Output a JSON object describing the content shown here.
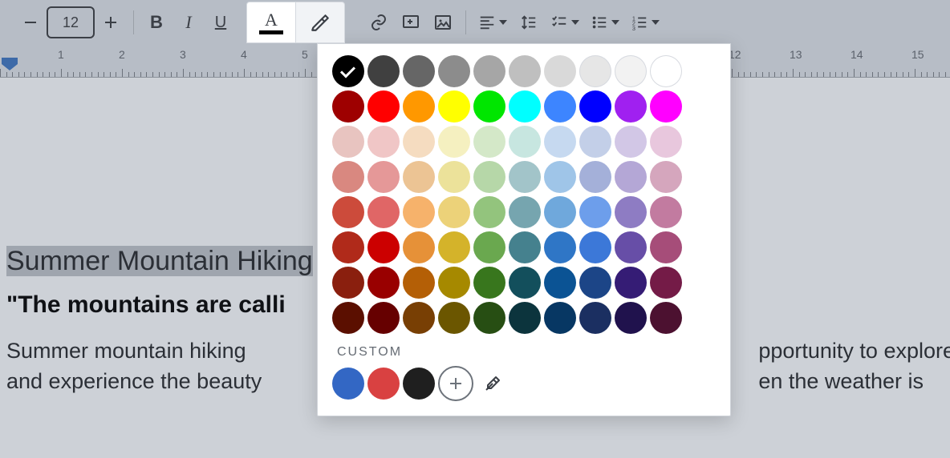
{
  "toolbar": {
    "font_size": "12"
  },
  "icons": {
    "bold": "B",
    "italic": "I",
    "underline": "U",
    "font_color_letter": "A"
  },
  "ruler": {
    "numbers": [
      1,
      2,
      3,
      4,
      5,
      12,
      13,
      14,
      15
    ]
  },
  "document": {
    "heading": "Summer Mountain Hiking",
    "quote_before": "\"The mountains are calli",
    "quote_after": "-",
    "body_before": "Summer mountain hiking",
    "body_mid": "and experience the beauty",
    "body_right_top": "pportunity to explore",
    "body_right_bot": "en the weather is"
  },
  "color_picker": {
    "custom_label": "CUSTOM",
    "selected": "#000000",
    "rows": [
      [
        "#000000",
        "#404040",
        "#666666",
        "#8c8c8c",
        "#a6a6a6",
        "#bfbfbf",
        "#d9d9d9",
        "#e6e6e6",
        "#f2f2f2",
        "#ffffff"
      ],
      [
        "#9e0000",
        "#ff0000",
        "#ff9800",
        "#ffff00",
        "#00e600",
        "#00ffff",
        "#3d85ff",
        "#0000ff",
        "#a020f0",
        "#ff00ff"
      ],
      [
        "#e8c4c0",
        "#f0c6c6",
        "#f5dcc0",
        "#f5f0c0",
        "#d4e8c8",
        "#c7e6e0",
        "#c6d9f0",
        "#c3cfe8",
        "#d2c7e6",
        "#e8c7dd"
      ],
      [
        "#d98880",
        "#e59898",
        "#ecc494",
        "#ece29a",
        "#b6d7a8",
        "#a2c4c9",
        "#9fc5e8",
        "#a4b0d9",
        "#b4a7d6",
        "#d5a6bd"
      ],
      [
        "#cc4b3b",
        "#e06666",
        "#f6b26b",
        "#ecd279",
        "#93c47d",
        "#76a5af",
        "#6fa8dc",
        "#6d9eeb",
        "#8e7cc3",
        "#c27ba0"
      ],
      [
        "#b02a1a",
        "#cc0000",
        "#e69138",
        "#d4b32a",
        "#6aa84f",
        "#45818e",
        "#2f76c6",
        "#3c78d8",
        "#674ea7",
        "#a64d79"
      ],
      [
        "#8a1f0e",
        "#990000",
        "#b45f06",
        "#a68900",
        "#38761d",
        "#134f5c",
        "#0b5394",
        "#1c4587",
        "#351c75",
        "#741b47"
      ],
      [
        "#5b0f00",
        "#660000",
        "#783f04",
        "#6b5600",
        "#274e13",
        "#0c343d",
        "#073763",
        "#1b2f61",
        "#20124d",
        "#4c1130"
      ]
    ],
    "custom_colors": [
      "#3367c4",
      "#d94141",
      "#1f1f1f"
    ]
  }
}
